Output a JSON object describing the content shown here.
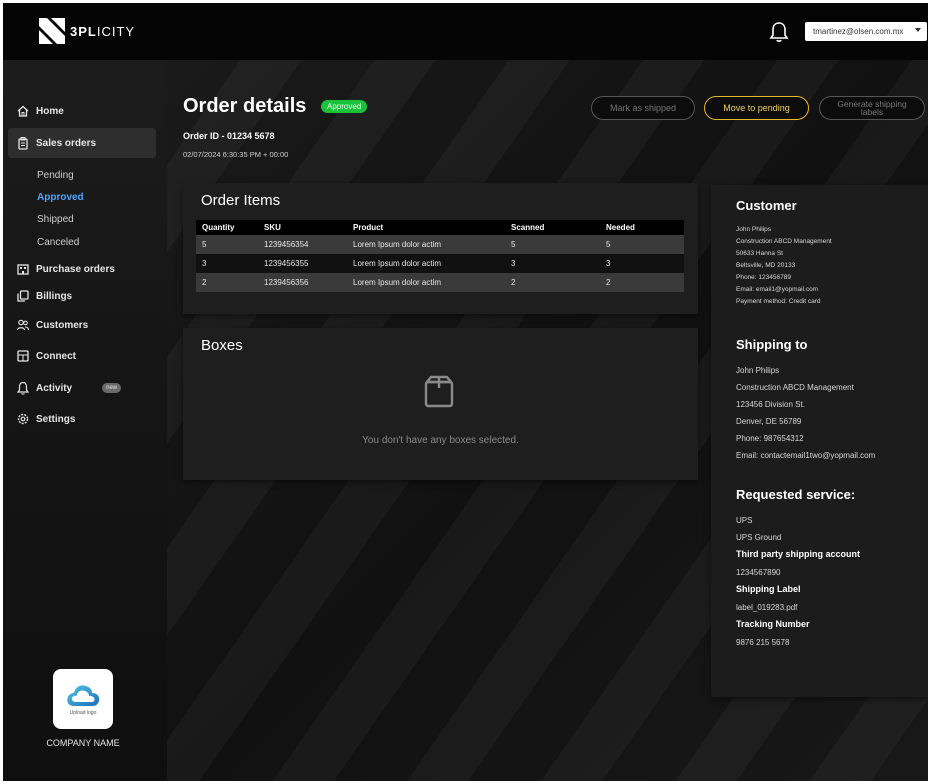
{
  "app": {
    "brand_bold": "3PL",
    "brand_thin": "ICITY"
  },
  "topbar": {
    "user_email": "tmartinez@olsen.com.mx"
  },
  "sidebar": {
    "items": [
      {
        "label": "Home"
      },
      {
        "label": "Sales orders"
      },
      {
        "label": "Purchase orders"
      },
      {
        "label": "Billings"
      },
      {
        "label": "Customers"
      },
      {
        "label": "Connect"
      },
      {
        "label": "Activity",
        "badge": "new"
      },
      {
        "label": "Settings"
      }
    ],
    "sub_items": [
      {
        "label": "Pending"
      },
      {
        "label": "Approved"
      },
      {
        "label": "Shipped"
      },
      {
        "label": "Canceled"
      }
    ],
    "upload_caption": "Upload logo",
    "company_name": "COMPANY NAME"
  },
  "order": {
    "title": "Order details",
    "status": "Approved",
    "id": "Order ID - 01234 5678",
    "date": "02/07/2024 6:30:35 PM + 00:00"
  },
  "actions": {
    "mark_shipped": "Mark as shipped",
    "move_pending": "Move to pending",
    "generate_labels": "Generate shipping labels"
  },
  "items_panel": {
    "title": "Order Items",
    "columns": [
      "Quantity",
      "SKU",
      "Product",
      "Scanned",
      "Needed"
    ],
    "rows": [
      [
        "5",
        "1239456354",
        "Lorem Ipsum dolor actim",
        "5",
        "5"
      ],
      [
        "3",
        "1239456355",
        "Lorem Ipsum dolor actim",
        "3",
        "3"
      ],
      [
        "2",
        "1239456356",
        "Lorem Ipsum dolor actim",
        "2",
        "2"
      ]
    ]
  },
  "boxes_panel": {
    "title": "Boxes",
    "empty_message": "You don't have any boxes selected."
  },
  "customer": {
    "title": "Customer",
    "lines": [
      "John Philips",
      "Construction ABCD Management",
      "50633 Hanna St",
      "Beltsville, MD 20133",
      "Phone: 123456789",
      "Email: email1@yopmail.com",
      "Payment method: Credit card"
    ]
  },
  "shipping": {
    "title": "Shipping to",
    "lines": [
      "John Philips",
      "Construction ABCD Management",
      "123456 Division St.",
      "Denver, DE 56789",
      "Phone: 987654312",
      "Email: contactemail1two@yopmail.com"
    ]
  },
  "service": {
    "title": "Requested service:",
    "carrier": "UPS",
    "method": "UPS Ground",
    "third_party_label": "Third party shipping account",
    "third_party_value": "1234567890",
    "label_title": "Shipping Label",
    "label_file": "label_019283.pdf",
    "tracking_title": "Tracking Number",
    "tracking_value": "9876 215 5678"
  },
  "colors": {
    "approved": "#19c23a",
    "pending_accent": "#e5b928",
    "active_sub": "#4da3ff"
  }
}
